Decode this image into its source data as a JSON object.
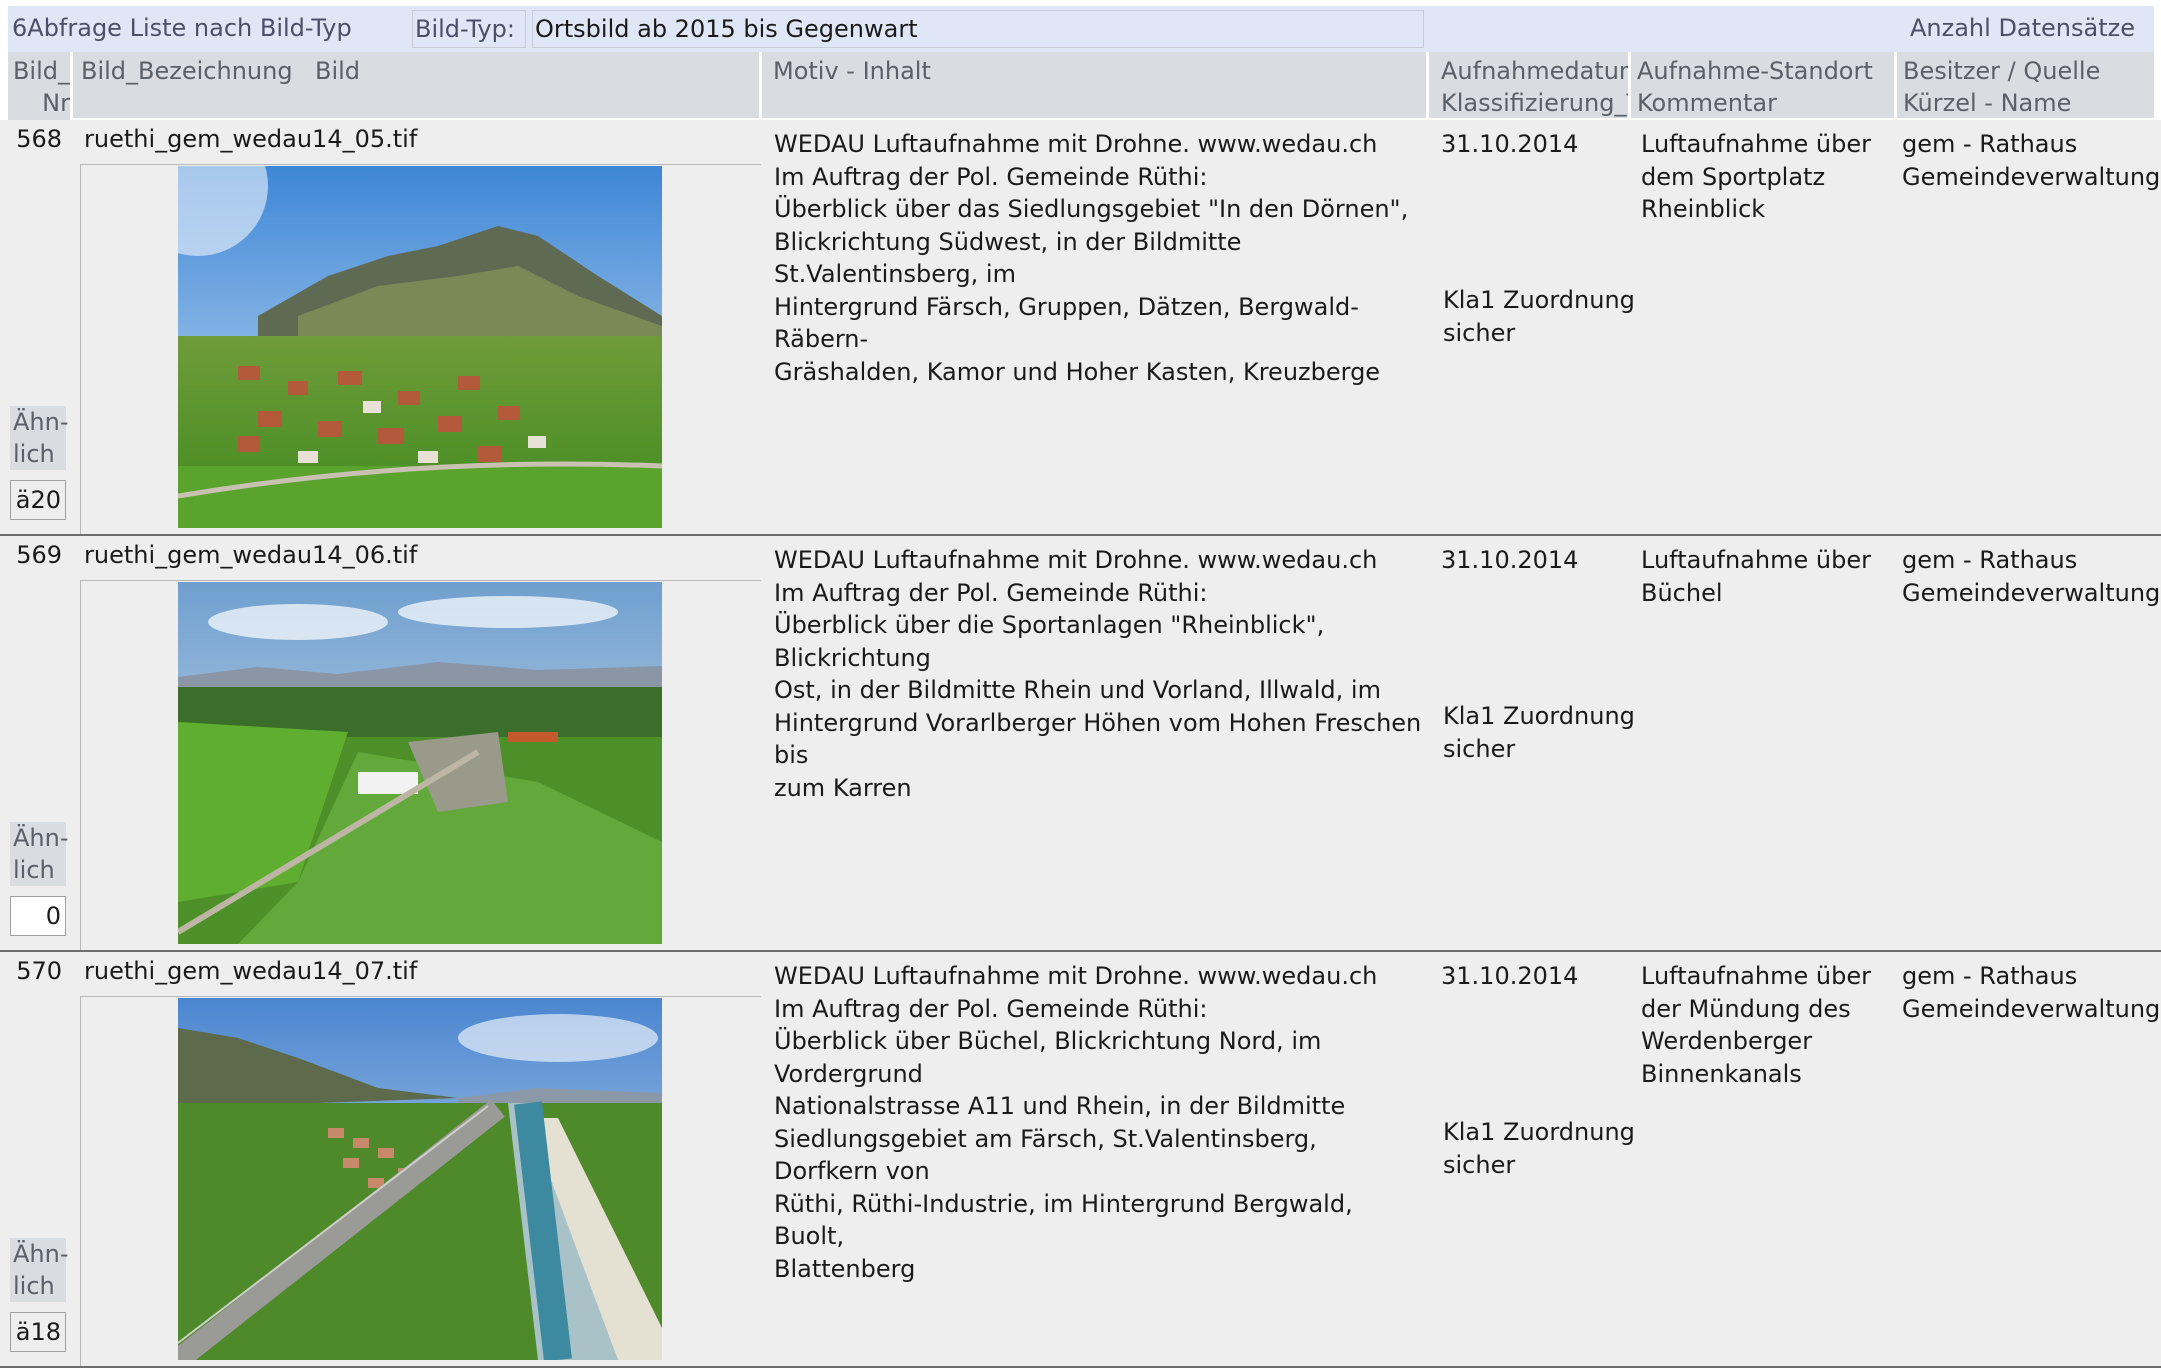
{
  "form": {
    "title": "6Abfrage Liste nach Bild-Typ",
    "filter_label": "Bild-Typ:",
    "filter_value": "Ortsbild ab 2015 bis Gegenwart",
    "count_label": "Anzahl Datensätze"
  },
  "columns": {
    "nr": "Bild_\nNr",
    "bezeichnung": "Bild_Bezeichnung",
    "bild": "Bild",
    "motiv": "Motiv - Inhalt",
    "datum": "Aufnahmedatum\nKlassifizierung_T",
    "standort": "Aufnahme-Standort\nKommentar",
    "besitzer": "Besitzer / Quelle\nKürzel - Name"
  },
  "records": [
    {
      "nr": "568",
      "filename": "ruethi_gem_wedau14_05.tif",
      "photo_icon": "aerial-village-photo",
      "motiv": "WEDAU Luftaufnahme mit Drohne. www.wedau.ch\nIm Auftrag der Pol. Gemeinde Rüthi:\nÜberblick über das Siedlungsgebiet \"In den Dörnen\",\nBlickrichtung Südwest, in der Bildmitte St.Valentinsberg, im\nHintergrund Färsch, Gruppen, Dätzen, Bergwald-Räbern-\nGräshalden, Kamor und Hoher Kasten, Kreuzberge",
      "datum": "31.10.2014",
      "klassifizierung": "Kla1 Zuordnung\nsicher",
      "standort": "Luftaufnahme über\ndem Sportplatz\nRheinblick",
      "besitzer": "gem - Rathaus\nGemeindeverwaltung",
      "aehnlich_label": "Ähn-\nlich",
      "aehnlich_value": "ä20"
    },
    {
      "nr": "569",
      "filename": "ruethi_gem_wedau14_06.tif",
      "photo_icon": "aerial-sports-field-photo",
      "motiv": "WEDAU Luftaufnahme mit Drohne. www.wedau.ch\nIm Auftrag der Pol. Gemeinde Rüthi:\nÜberblick über die Sportanlagen \"Rheinblick\", Blickrichtung\nOst, in der Bildmitte Rhein und Vorland, Illwald, im\nHintergrund Vorarlberger Höhen vom Hohen Freschen bis\nzum Karren",
      "datum": "31.10.2014",
      "klassifizierung": "Kla1 Zuordnung\nsicher",
      "standort": "Luftaufnahme über\nBüchel",
      "besitzer": "gem - Rathaus\nGemeindeverwaltung",
      "aehnlich_label": "Ähn-\nlich",
      "aehnlich_value": "0"
    },
    {
      "nr": "570",
      "filename": "ruethi_gem_wedau14_07.tif",
      "photo_icon": "aerial-river-highway-photo",
      "motiv": "WEDAU Luftaufnahme mit Drohne. www.wedau.ch\nIm Auftrag der Pol. Gemeinde Rüthi:\nÜberblick über Büchel, Blickrichtung Nord, im Vordergrund\nNationalstrasse A11 und Rhein, in der Bildmitte\nSiedlungsgebiet am Färsch, St.Valentinsberg, Dorfkern von\nRüthi, Rüthi-Industrie, im Hintergrund Bergwald, Buolt,\nBlattenberg",
      "datum": "31.10.2014",
      "klassifizierung": "Kla1 Zuordnung\nsicher",
      "standort": "Luftaufnahme über\nder Mündung des\nWerdenberger\nBinnenkanals",
      "besitzer": "gem - Rathaus\nGemeindeverwaltung",
      "aehnlich_label": "Ähn-\nlich",
      "aehnlich_value": "ä18"
    }
  ]
}
